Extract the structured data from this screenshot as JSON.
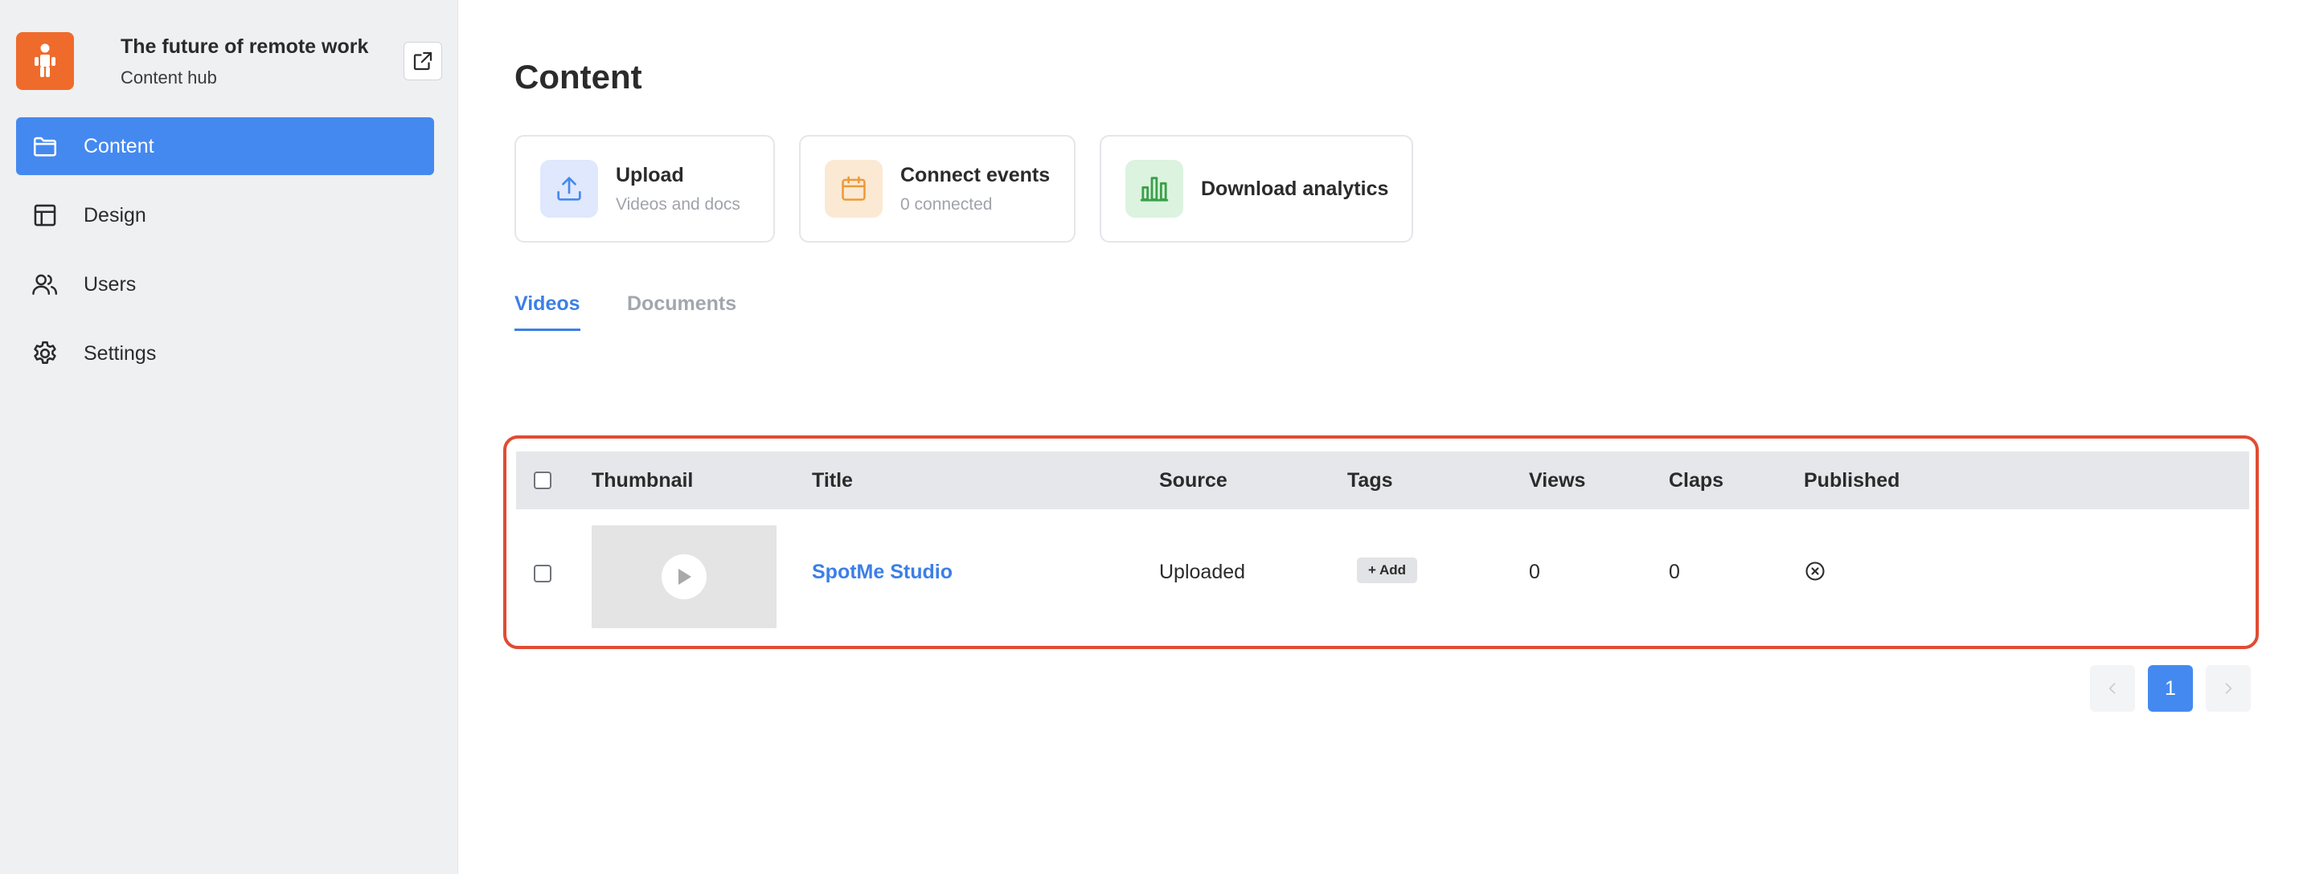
{
  "brand": {
    "title": "The future of remote work",
    "subtitle": "Content hub",
    "logo_color": "#ef6b2b",
    "open_external_icon": "external-link-icon"
  },
  "sidebar": {
    "items": [
      {
        "label": "Content",
        "icon": "folder-icon",
        "active": true
      },
      {
        "label": "Design",
        "icon": "layout-icon",
        "active": false
      },
      {
        "label": "Users",
        "icon": "users-icon",
        "active": false
      },
      {
        "label": "Settings",
        "icon": "gear-icon",
        "active": false
      }
    ]
  },
  "main": {
    "title": "Content",
    "cards": [
      {
        "title": "Upload",
        "subtitle": "Videos and docs",
        "icon": "upload-icon"
      },
      {
        "title": "Connect events",
        "subtitle": "0 connected",
        "icon": "calendar-icon"
      },
      {
        "title": "Download analytics",
        "subtitle": "",
        "icon": "bar-chart-icon"
      }
    ],
    "tabs": [
      {
        "label": "Videos",
        "active": true
      },
      {
        "label": "Documents",
        "active": false
      }
    ]
  },
  "table": {
    "columns": [
      "Thumbnail",
      "Title",
      "Source",
      "Tags",
      "Views",
      "Claps",
      "Published"
    ],
    "rows": [
      {
        "title": "SpotMe Studio",
        "source": "Uploaded",
        "tag_add_label": "+ Add",
        "views": "0",
        "claps": "0",
        "published_icon": "x-circle-icon"
      }
    ]
  },
  "pagination": {
    "current_page": "1",
    "prev_icon": "chevron-left-icon",
    "next_icon": "chevron-right-icon"
  },
  "colors": {
    "accent": "#4489f0",
    "highlight_outline": "#e14b33",
    "sidebar_bg": "#eff0f2"
  }
}
